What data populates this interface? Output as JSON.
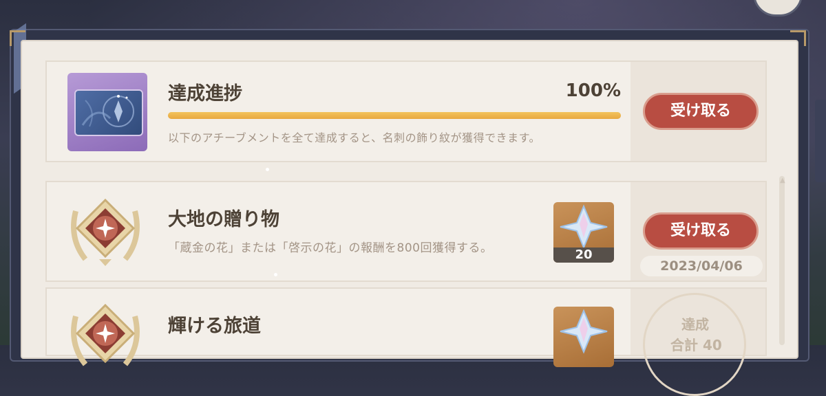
{
  "progress_card": {
    "title": "達成進捗",
    "percent_label": "100%",
    "progress_fraction": 1.0,
    "description": "以下のアチーブメントを全て達成すると、名刺の飾り紋が獲得できます。",
    "claim_label": "受け取る"
  },
  "achievements": [
    {
      "title": "大地の贈り物",
      "description": "「蔵金の花」または「啓示の花」の報酬を800回獲得する。",
      "reward_count": "20",
      "claim_label": "受け取る",
      "date": "2023/04/06"
    },
    {
      "title": "輝ける旅道",
      "status_line1": "達成",
      "status_line2": "合計 40"
    }
  ],
  "colors": {
    "claim_button": "#b84d42",
    "progress_fill": "#e9a83f",
    "panel_bg": "#f0ebe4"
  },
  "icons": [
    "namecard-icon",
    "achievement-laurel-icon",
    "primogem-icon",
    "completion-seal-icon"
  ]
}
